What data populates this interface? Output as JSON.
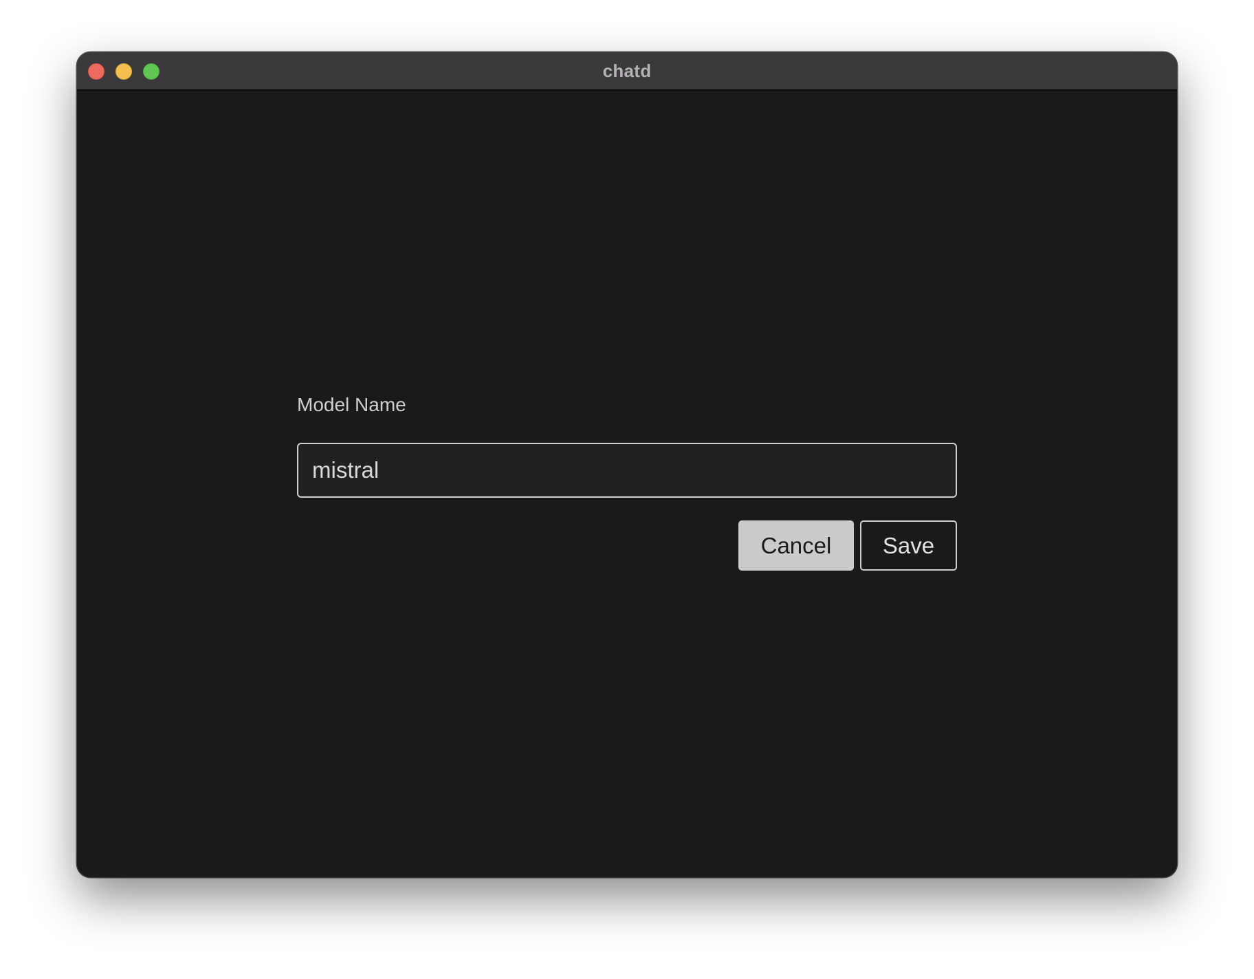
{
  "window": {
    "title": "chatd",
    "controls": [
      "close-icon",
      "minimize-icon",
      "zoom-icon"
    ]
  },
  "form": {
    "label": "Model Name",
    "input_value": "mistral",
    "cancel_label": "Cancel",
    "save_label": "Save"
  },
  "colors": {
    "background": "#1a1a1a",
    "titlebar": "#3b383c",
    "close": "#ec6a5e",
    "minimize": "#f4bf4f",
    "zoom": "#61c554",
    "cancel_button": "#cbcbcb"
  }
}
